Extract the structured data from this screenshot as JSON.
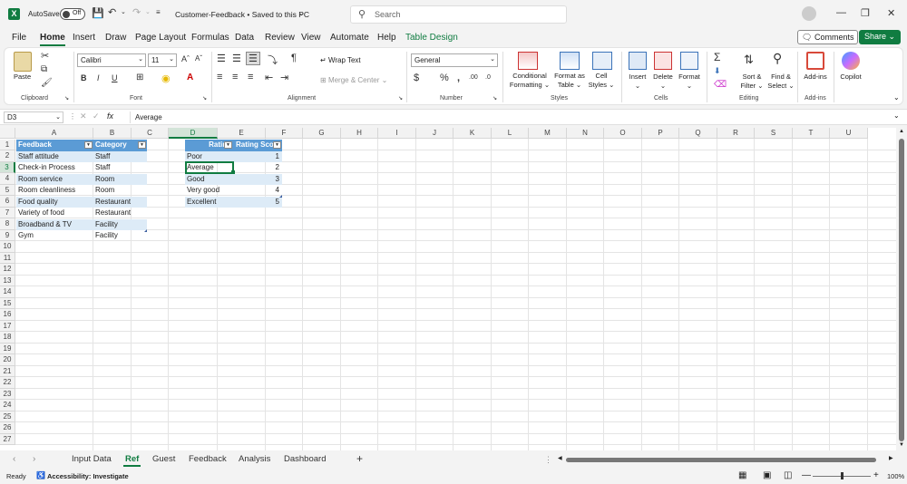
{
  "titlebar": {
    "autosave_label": "AutoSave",
    "autosave_state": "Off",
    "doc_title": "Customer-Feedback • Saved to this PC",
    "search_placeholder": "Search"
  },
  "menu": {
    "tabs": [
      "File",
      "Home",
      "Insert",
      "Draw",
      "Page Layout",
      "Formulas",
      "Data",
      "Review",
      "View",
      "Automate",
      "Help",
      "Table Design"
    ],
    "active": "Home",
    "comments": "Comments",
    "share": "Share"
  },
  "ribbon": {
    "clipboard": {
      "paste": "Paste",
      "label": "Clipboard"
    },
    "font": {
      "name": "Calibri",
      "size": "11",
      "label": "Font"
    },
    "alignment": {
      "wrap": "Wrap Text",
      "merge": "Merge & Center",
      "label": "Alignment"
    },
    "number": {
      "format": "General",
      "label": "Number"
    },
    "styles": {
      "cond1": "Conditional",
      "cond2": "Formatting",
      "fmt1": "Format as",
      "fmt2": "Table",
      "cell1": "Cell",
      "cell2": "Styles",
      "label": "Styles"
    },
    "cells": {
      "insert": "Insert",
      "delete": "Delete",
      "format": "Format",
      "label": "Cells"
    },
    "editing": {
      "sort1": "Sort &",
      "sort2": "Filter",
      "find1": "Find &",
      "find2": "Select",
      "label": "Editing"
    },
    "addins": {
      "addins": "Add-ins",
      "label": "Add-ins"
    },
    "copilot": {
      "label": "Copilot"
    }
  },
  "formula": {
    "namebox": "D3",
    "content": "Average"
  },
  "columns": [
    "A",
    "B",
    "C",
    "D",
    "E",
    "F",
    "G",
    "H",
    "I",
    "J",
    "K",
    "L",
    "M",
    "N",
    "O",
    "P",
    "Q",
    "R",
    "S",
    "T",
    "U"
  ],
  "rows": [
    "1",
    "2",
    "3",
    "4",
    "5",
    "6",
    "7",
    "8",
    "9",
    "10",
    "11",
    "12",
    "13",
    "14",
    "15",
    "16",
    "17",
    "18",
    "19",
    "20",
    "21",
    "22",
    "23",
    "24",
    "25",
    "26",
    "27"
  ],
  "table1": {
    "headers": [
      "Feedback",
      "Category"
    ],
    "rows": [
      [
        "Staff attitude",
        "Staff"
      ],
      [
        "Check-in Process",
        "Staff"
      ],
      [
        "Room service",
        "Room"
      ],
      [
        "Room cleanliness",
        "Room"
      ],
      [
        "Food quality",
        "Restaurant"
      ],
      [
        "Variety of food",
        "Restaurant"
      ],
      [
        "Broadband & TV",
        "Facility"
      ],
      [
        "Gym",
        "Facility"
      ]
    ]
  },
  "table2": {
    "headers": [
      "Rating",
      "Rating Sco"
    ],
    "rows": [
      [
        "Poor",
        "1"
      ],
      [
        "Average",
        "2"
      ],
      [
        "Good",
        "3"
      ],
      [
        "Very good",
        "4"
      ],
      [
        "Excellent",
        "5"
      ]
    ]
  },
  "sheets": {
    "tabs": [
      "Input Data",
      "Ref",
      "Guest",
      "Feedback",
      "Analysis",
      "Dashboard"
    ],
    "active": "Ref",
    "add": "+"
  },
  "status": {
    "ready": "Ready",
    "accessibility": "Accessibility: Investigate",
    "zoom": "100%"
  }
}
